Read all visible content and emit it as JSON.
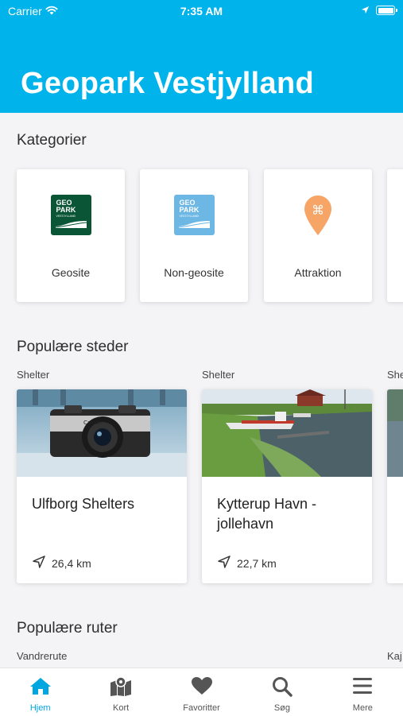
{
  "status_bar": {
    "carrier": "Carrier",
    "time": "7:35 AM"
  },
  "header": {
    "title": "Geopark Vestjylland"
  },
  "categories": {
    "title": "Kategorier",
    "items": [
      {
        "label": "Geosite",
        "icon": "geopark-logo-dark-green-icon",
        "color": "#0a5536"
      },
      {
        "label": "Non-geosite",
        "icon": "geopark-logo-light-blue-icon",
        "color": "#6cb7e3"
      },
      {
        "label": "Attraktion",
        "icon": "attraction-map-pin-icon",
        "color": "#f6a567"
      }
    ]
  },
  "popular_places": {
    "title": "Populære steder",
    "items": [
      {
        "type": "Shelter",
        "name": "Ulfborg Shelters",
        "distance": "26,4 km"
      },
      {
        "type": "Shelter",
        "name": "Kytterup Havn - jollehavn",
        "distance": "22,7 km"
      },
      {
        "type": "She"
      }
    ]
  },
  "popular_routes": {
    "title": "Populære ruter",
    "items": [
      {
        "type": "Vandrerute"
      },
      {
        "type": "Kaj"
      }
    ]
  },
  "tabs": [
    {
      "label": "Hjem",
      "icon": "home-icon",
      "active": true
    },
    {
      "label": "Kort",
      "icon": "map-icon",
      "active": false
    },
    {
      "label": "Favoritter",
      "icon": "heart-icon",
      "active": false
    },
    {
      "label": "Søg",
      "icon": "search-icon",
      "active": false
    },
    {
      "label": "Mere",
      "icon": "menu-icon",
      "active": false
    }
  ],
  "colors": {
    "header": "#00b3ea",
    "accent": "#00a6e0",
    "background": "#f4f4f6"
  }
}
